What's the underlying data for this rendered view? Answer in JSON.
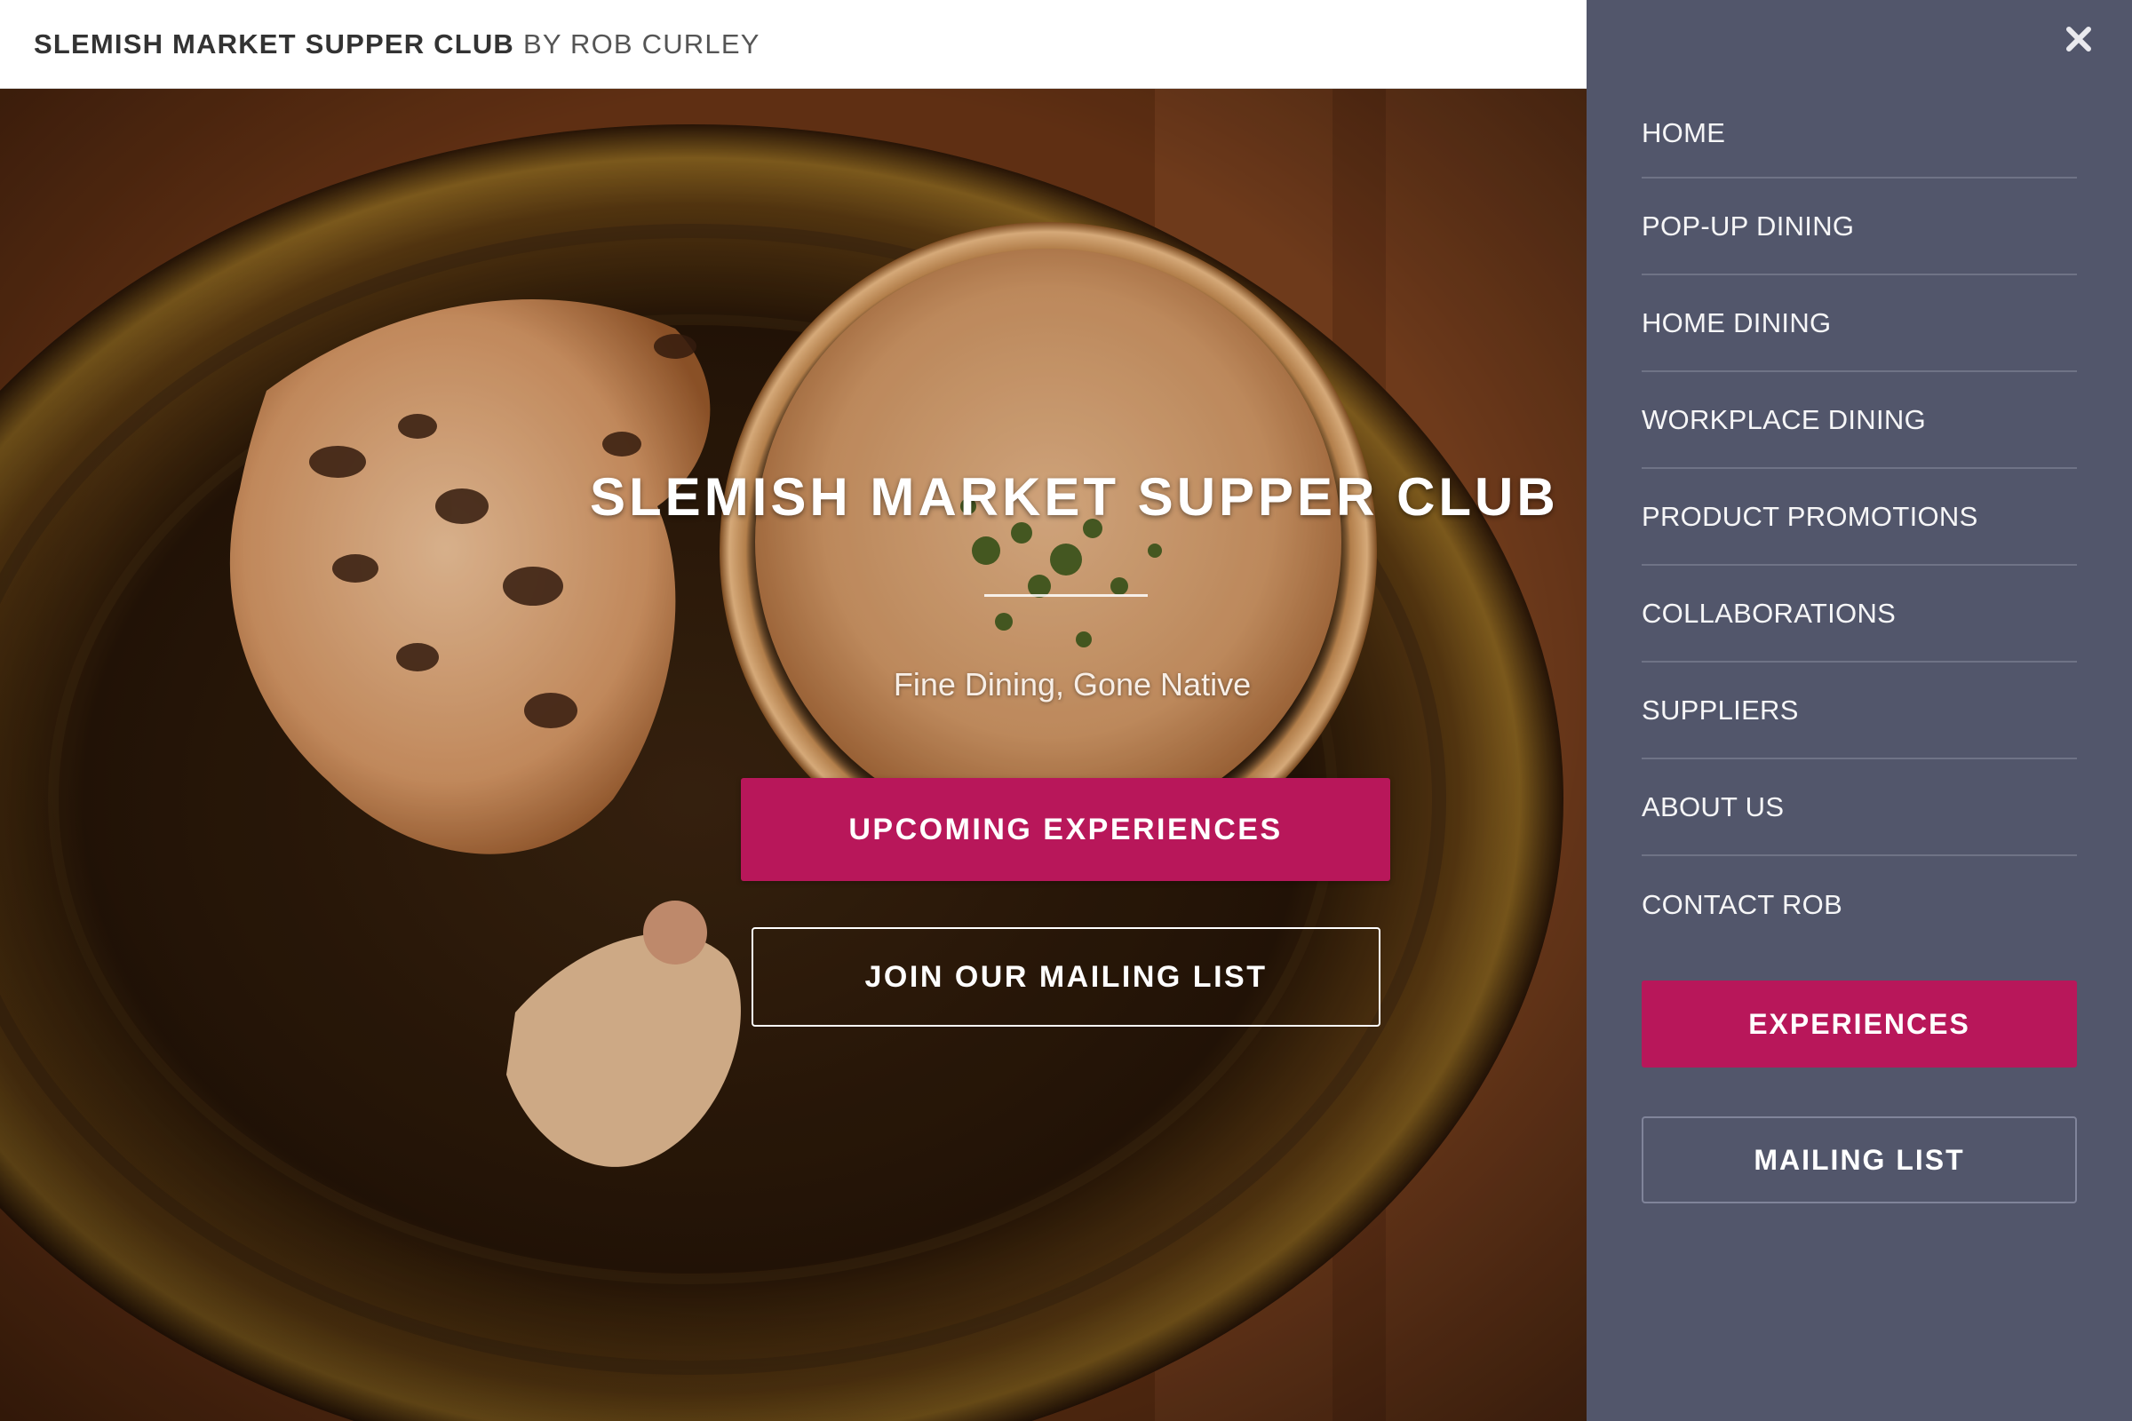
{
  "header": {
    "brand_main": "SLEMISH MARKET SUPPER CLUB",
    "brand_by": "BY ROB CURLEY"
  },
  "hero": {
    "title": "SLEMISH MARKET SUPPER CLUB",
    "tagline": "Fine Dining, Gone Native",
    "primary_button": "UPCOMING EXPERIENCES",
    "secondary_button": "JOIN OUR MAILING LIST",
    "background_image": "plate of food with flatbread and a glass of soup topped with herbs"
  },
  "side_nav": {
    "close_icon": "close-icon",
    "items": [
      {
        "label": "HOME"
      },
      {
        "label": "POP-UP DINING"
      },
      {
        "label": "HOME DINING"
      },
      {
        "label": "WORKPLACE DINING"
      },
      {
        "label": "PRODUCT PROMOTIONS"
      },
      {
        "label": "COLLABORATIONS"
      },
      {
        "label": "SUPPLIERS"
      },
      {
        "label": "ABOUT US"
      },
      {
        "label": "CONTACT ROB"
      }
    ],
    "primary_button": "EXPERIENCES",
    "secondary_button": "MAILING LIST"
  },
  "colors": {
    "accent": "#b8175a",
    "nav_background": "#52566b",
    "header_background": "#ffffff",
    "header_text": "#333333"
  }
}
